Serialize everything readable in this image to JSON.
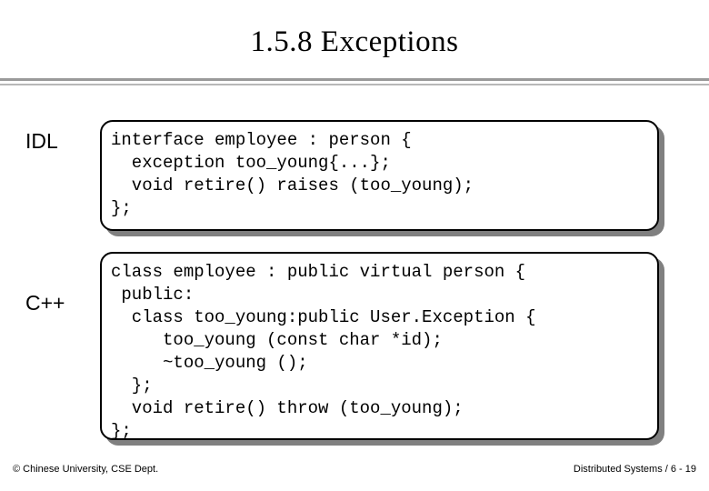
{
  "slide": {
    "title": "1.5.8 Exceptions",
    "rows": [
      {
        "label": "IDL",
        "code": "interface employee : person {\n  exception too_young{...};\n  void retire() raises (too_young);\n};"
      },
      {
        "label": "C++",
        "code": "class employee : public virtual person {\n public:\n  class too_young:public User.Exception {\n     too_young (const char *id);\n     ~too_young ();\n  };\n  void retire() throw (too_young);\n};"
      }
    ],
    "footer": {
      "left": "© Chinese University, CSE Dept.",
      "right": "Distributed Systems / 6 - 19"
    }
  }
}
